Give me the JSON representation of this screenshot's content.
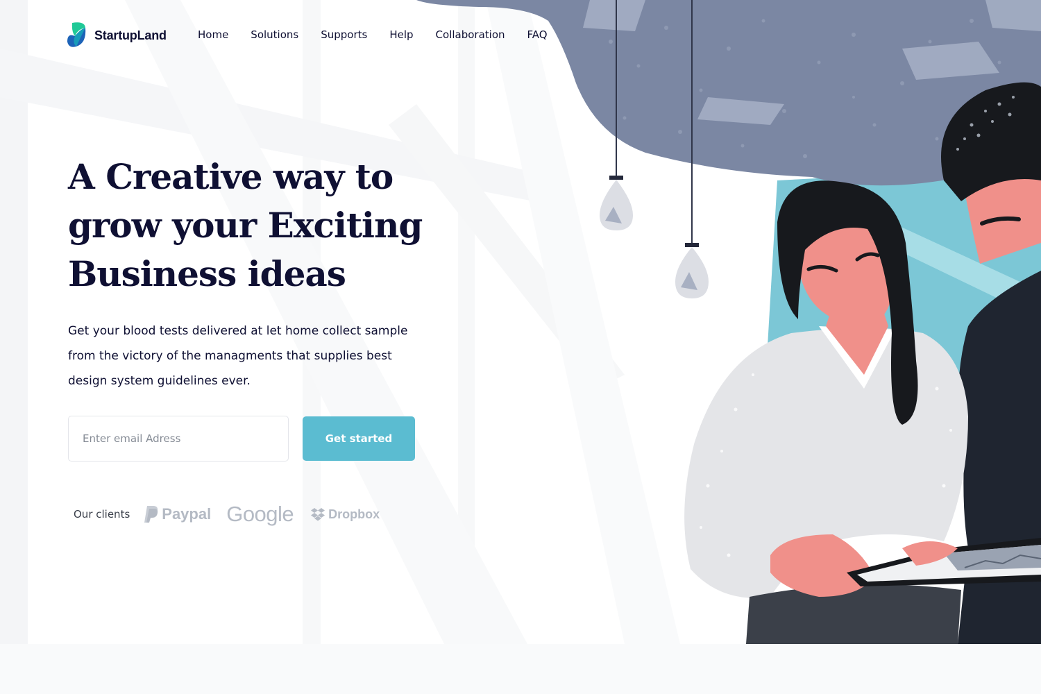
{
  "brand": {
    "name": "StartupLand"
  },
  "nav": {
    "items": [
      {
        "label": "Home"
      },
      {
        "label": "Solutions"
      },
      {
        "label": "Supports"
      },
      {
        "label": "Help"
      },
      {
        "label": "Collaboration"
      },
      {
        "label": "FAQ"
      }
    ]
  },
  "hero": {
    "title_lines": [
      "A Creative way to",
      "grow your Exciting",
      "Business ideas"
    ],
    "description": "Get your blood tests delivered at let home collect sample from the victory of the managments that supplies best design system guidelines ever.",
    "email_placeholder": "Enter email Adress",
    "email_value": "",
    "cta_label": "Get started"
  },
  "clients": {
    "label": "Our clients",
    "logos": [
      {
        "name": "Paypal",
        "icon": "paypal-icon"
      },
      {
        "name": "Google",
        "icon": ""
      },
      {
        "name": "Dropbox",
        "icon": "dropbox-icon"
      }
    ]
  },
  "colors": {
    "accent": "#5bbcd1",
    "heading": "#0f1033",
    "client_logo": "#b4bac4",
    "ceiling": "#7b87a3",
    "skin": "#f0908a",
    "hair": "#17191d"
  }
}
